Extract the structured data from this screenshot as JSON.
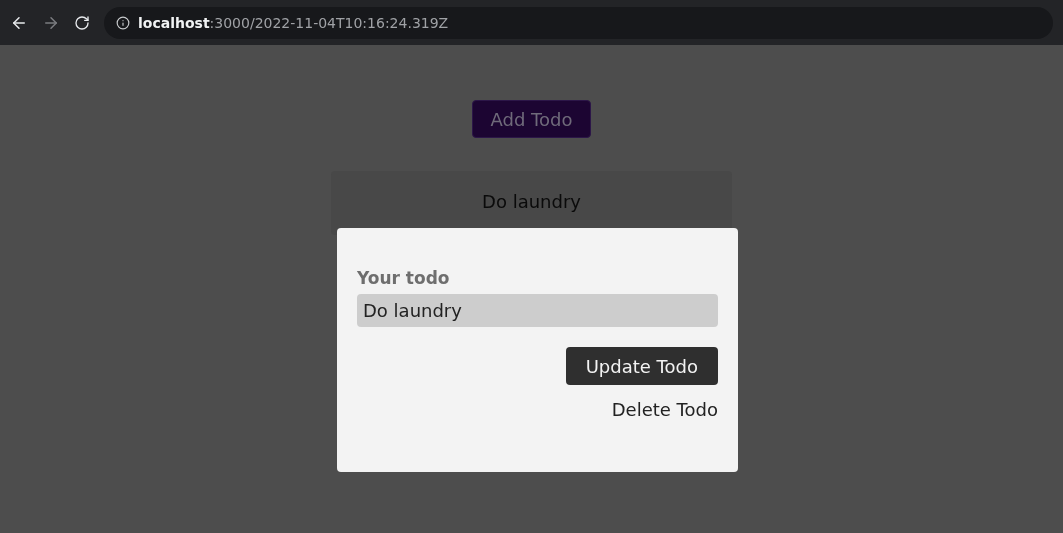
{
  "browser": {
    "address": "**localhost**:3000/2022-11-04T10:16:24.319Z"
  },
  "add_button": "Add Todo",
  "todos": [
    "Do laundry"
  ],
  "modal": {
    "label": "Your todo",
    "value": "Do laundry",
    "update_button": "Update Todo",
    "delete_button": "Delete Todo"
  }
}
